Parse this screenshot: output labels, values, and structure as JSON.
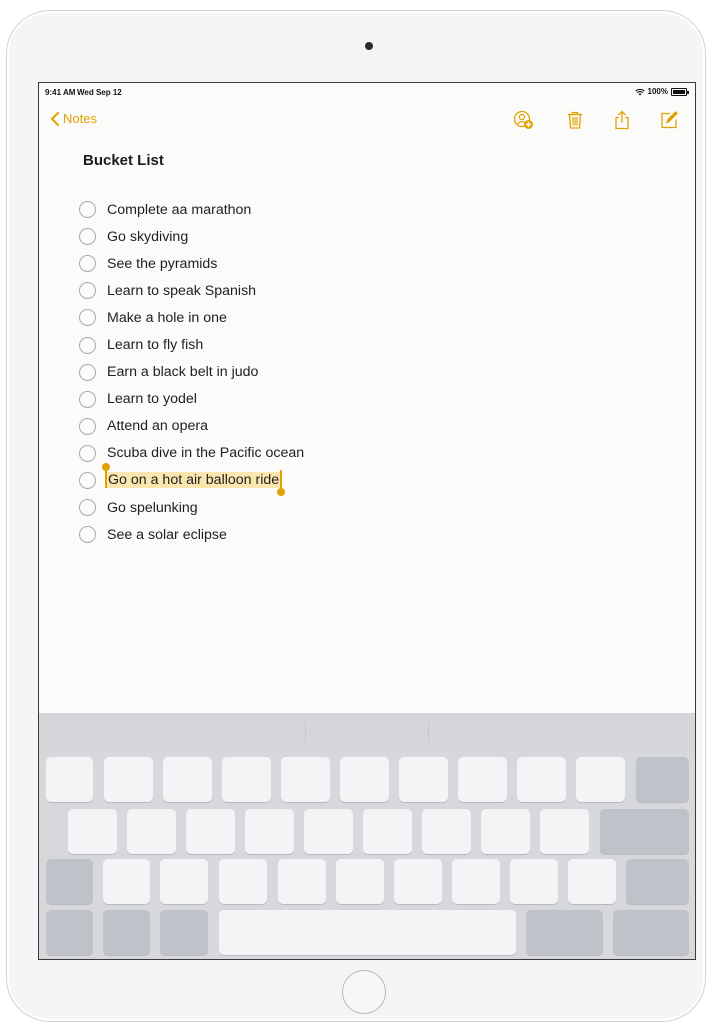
{
  "status_bar": {
    "time": "9:41 AM",
    "date": "Wed Sep 12",
    "wifi_icon": "wifi-icon",
    "battery_percent": "100%"
  },
  "nav": {
    "back_label": "Notes",
    "accent_color": "#e1a100",
    "icons": [
      "add-people-icon",
      "trash-icon",
      "share-icon",
      "compose-icon"
    ]
  },
  "note": {
    "title": "Bucket List",
    "items": [
      {
        "text": "Complete aa marathon",
        "checked": false
      },
      {
        "text": "Go skydiving",
        "checked": false
      },
      {
        "text": "See the pyramids",
        "checked": false
      },
      {
        "text": "Learn to speak Spanish",
        "checked": false
      },
      {
        "text": "Make a hole in one",
        "checked": false
      },
      {
        "text": "Learn to fly fish",
        "checked": false
      },
      {
        "text": "Earn a black belt in judo",
        "checked": false
      },
      {
        "text": "Learn to yodel",
        "checked": false
      },
      {
        "text": "Attend an opera",
        "checked": false
      },
      {
        "text": "Scuba dive in the Pacific ocean",
        "checked": false
      },
      {
        "text": "Go on a hot air balloon ride",
        "checked": false,
        "selected": true
      },
      {
        "text": "Go spelunking",
        "checked": false
      },
      {
        "text": "See a solar eclipse",
        "checked": false
      }
    ],
    "selection_color": "#fbe6b0"
  }
}
